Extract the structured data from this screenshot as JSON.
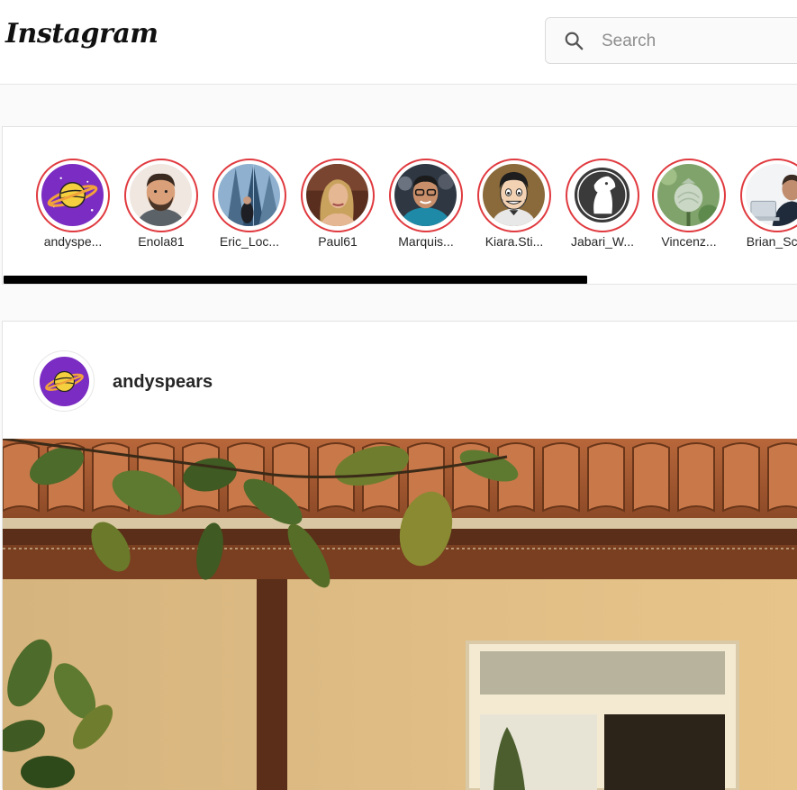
{
  "header": {
    "logo": "Instagram",
    "search_placeholder": "Search"
  },
  "stories": [
    {
      "name": "andyspe...",
      "avatar": "planet-avatar"
    },
    {
      "name": "Enola81",
      "avatar": "man-beard-avatar"
    },
    {
      "name": "Eric_Loc...",
      "avatar": "city-avatar"
    },
    {
      "name": "Paul61",
      "avatar": "woman-blonde-avatar"
    },
    {
      "name": "Marquis...",
      "avatar": "man-glasses-avatar"
    },
    {
      "name": "Kiara.Sti...",
      "avatar": "cartoon-man-avatar"
    },
    {
      "name": "Jabari_W...",
      "avatar": "horse-logo-avatar"
    },
    {
      "name": "Vincenz...",
      "avatar": "poppy-pod-avatar"
    },
    {
      "name": "Brian_Sc...",
      "avatar": "man-laptop-avatar"
    }
  ],
  "post": {
    "username": "andyspears",
    "image": "house-roof-leaves-photo"
  },
  "colors": {
    "story_ring": "#e03a3f",
    "scrollbar": "#000000"
  }
}
